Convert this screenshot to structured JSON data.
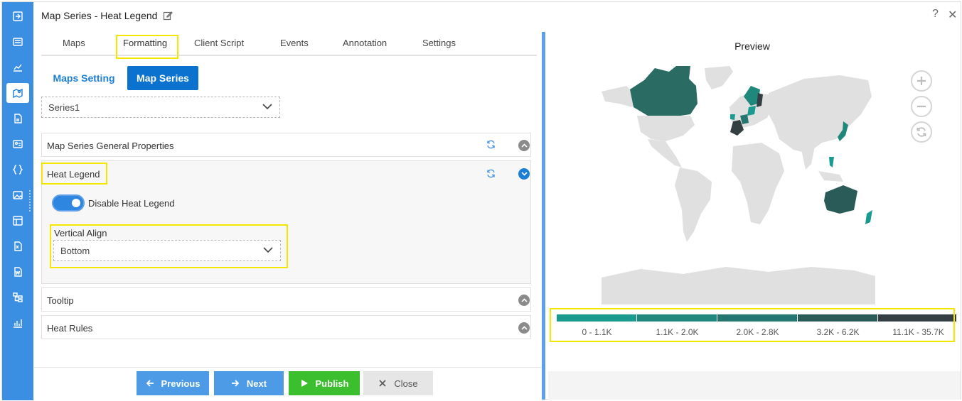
{
  "window": {
    "title": "Map Series - Heat Legend",
    "help_glyph": "?",
    "close_glyph": "✕"
  },
  "rail": {
    "icons": [
      "sign-in-icon",
      "list-icon",
      "chart-icon",
      "map-icon",
      "document-icon",
      "contact-card-icon",
      "braces-icon",
      "image-icon",
      "table-icon",
      "excel-icon",
      "word-icon",
      "hierarchy-icon",
      "bar-chart-icon"
    ],
    "active_index": 3
  },
  "tabs": [
    "Maps",
    "Formatting",
    "Client Script",
    "Events",
    "Annotation",
    "Settings"
  ],
  "active_tab": "Formatting",
  "sub_tabs": {
    "maps_setting": "Maps Setting",
    "map_series": "Map Series"
  },
  "series_select": {
    "value": "Series1"
  },
  "panels": {
    "general": "Map Series General Properties",
    "heat_legend": "Heat Legend",
    "tooltip": "Tooltip",
    "heat_rules": "Heat Rules"
  },
  "heat_legend": {
    "toggle_label": "Disable Heat Legend",
    "toggle_on": true,
    "vertical_align_label": "Vertical Align",
    "vertical_align_value": "Bottom"
  },
  "footer": {
    "previous": "Previous",
    "next": "Next",
    "publish": "Publish",
    "close": "Close"
  },
  "preview": {
    "title": "Preview",
    "legend": [
      {
        "label": "0 - 1.1K",
        "color": "#1b9a8f"
      },
      {
        "label": "1.1K - 2.0K",
        "color": "#20877d"
      },
      {
        "label": "2.0K - 2.8K",
        "color": "#257570"
      },
      {
        "label": "3.2K - 6.2K",
        "color": "#2b5b59"
      },
      {
        "label": "11.1K - 35.7K",
        "color": "#343f44"
      }
    ]
  },
  "colors": {
    "accent": "#0b72cf",
    "rail": "#3b8fe2",
    "publish": "#3cbf2f",
    "nav_button": "#4d9be6",
    "close_button": "#e6e6e6",
    "highlight": "#f5e600"
  }
}
